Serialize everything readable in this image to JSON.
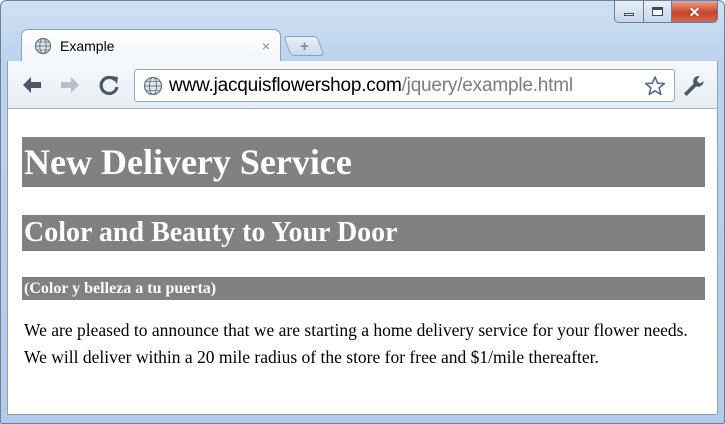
{
  "window": {
    "controls": {
      "minimize": "minimize",
      "maximize": "maximize",
      "close": "✕"
    }
  },
  "tab": {
    "title": "Example",
    "close_glyph": "×",
    "icon": "globe-icon"
  },
  "new_tab": {
    "glyph": "+"
  },
  "toolbar": {
    "back_icon": "back-arrow-icon",
    "forward_icon": "forward-arrow-icon",
    "reload_icon": "reload-icon",
    "url_host": "www.jacquisflowershop.com",
    "url_path": "/jquery/example.html",
    "bookmark_icon": "star-icon",
    "menu_icon": "wrench-icon"
  },
  "page": {
    "h1": "New Delivery Service",
    "h2": "Color and Beauty to Your Door",
    "h3": "(Color y belleza a tu puerta)",
    "paragraph": "We are pleased to announce that we are starting a home delivery service for your flower needs. We will deliver within a 20 mile radius of the store for free and $1/mile thereafter.",
    "heading_bg": "#7f8280"
  }
}
